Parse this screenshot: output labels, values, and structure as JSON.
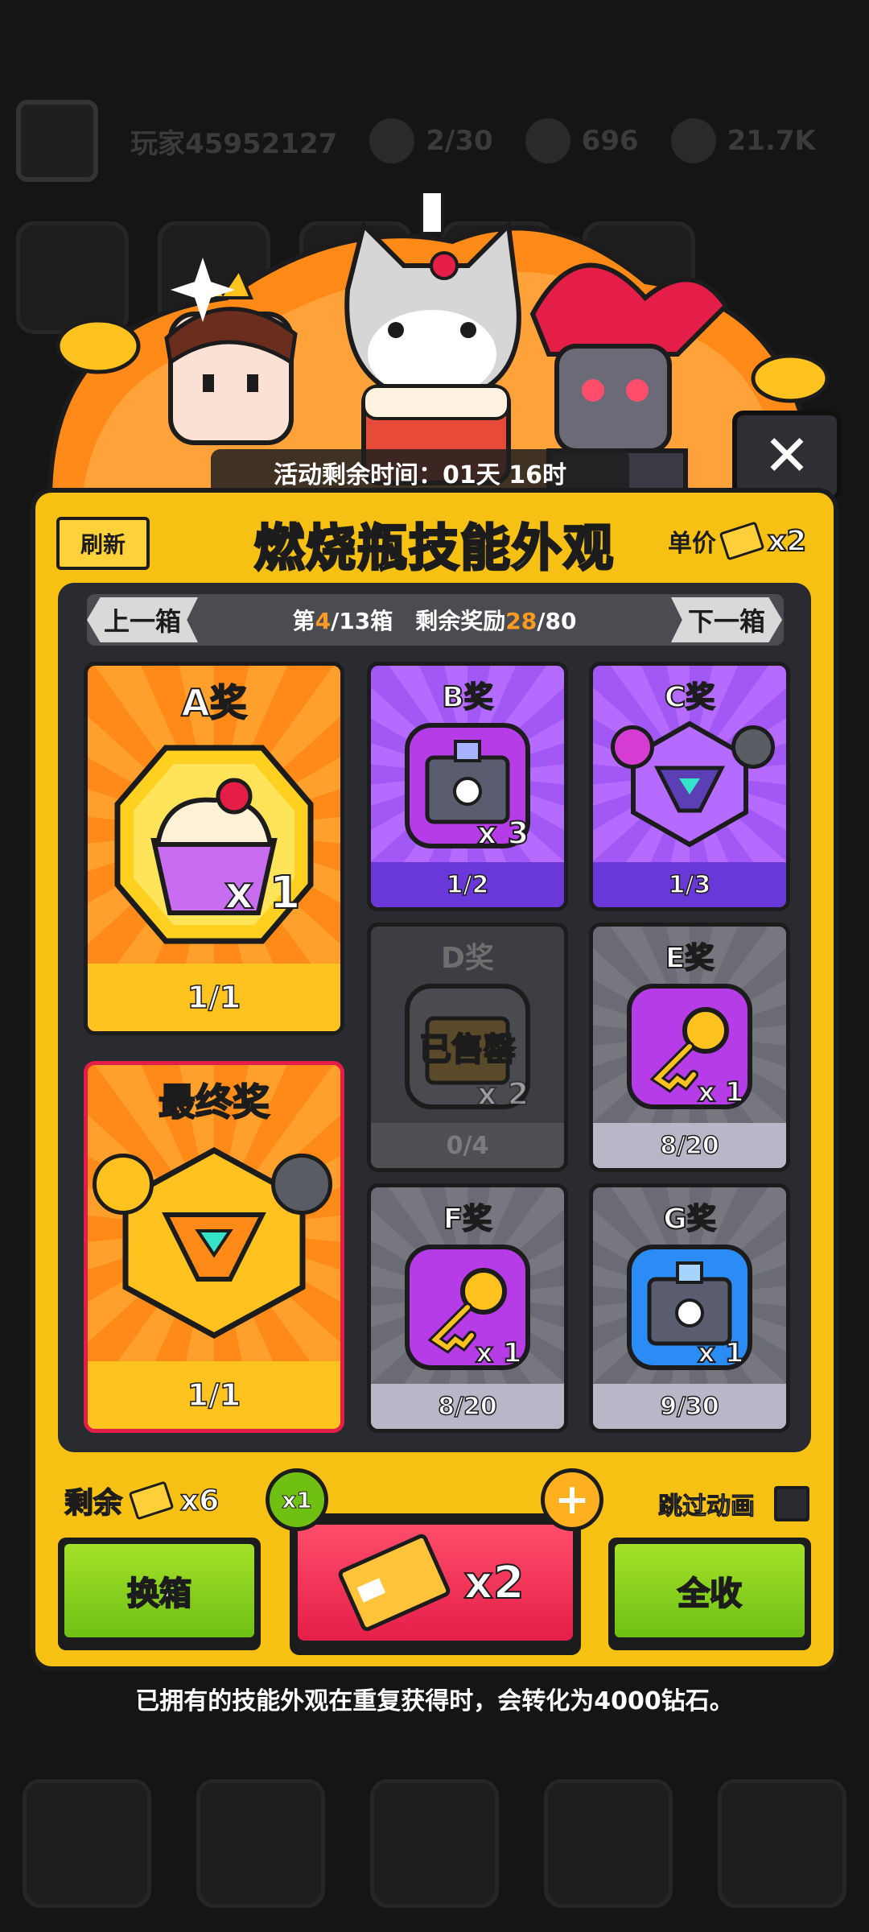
{
  "background": {
    "player_name": "玩家45952127",
    "stamina": "2/30",
    "gems": "696",
    "coins": "21.7K"
  },
  "event": {
    "timer_text": "活动剩余时间：01天 16时",
    "title": "燃烧瓶技能外观",
    "refresh_label": "刷新",
    "unit_price_label": "单价",
    "unit_price_qty": "x2"
  },
  "nav": {
    "prev_label": "上一箱",
    "next_label": "下一箱",
    "box_prefix": "第",
    "box_current": "4",
    "box_suffix": "/13箱",
    "reward_prefix": "剩余奖励",
    "reward_current": "28",
    "reward_suffix": "/80"
  },
  "prizes": [
    {
      "name": "A奖",
      "count": "1/1",
      "mult": "x 1",
      "icon": "cupcake-icon"
    },
    {
      "name": "B奖",
      "count": "1/2",
      "mult": "x 3",
      "icon": "chest-icon"
    },
    {
      "name": "C奖",
      "count": "1/3",
      "mult": "",
      "icon": "skill-emblem-icon"
    },
    {
      "name": "D奖",
      "count": "0/4",
      "mult": "x 2",
      "icon": "chest-icon",
      "sold_label": "已售罄"
    },
    {
      "name": "E奖",
      "count": "8/20",
      "mult": "x 1",
      "icon": "key-icon"
    },
    {
      "name": "最终奖",
      "count": "1/1",
      "mult": "",
      "icon": "skill-emblem-icon"
    },
    {
      "name": "F奖",
      "count": "8/20",
      "mult": "x 1",
      "icon": "key-icon"
    },
    {
      "name": "G奖",
      "count": "9/30",
      "mult": "x 1",
      "icon": "chest-icon"
    }
  ],
  "footer": {
    "remain_label": "剩余",
    "remain_qty": "x6",
    "skip_label": "跳过动画",
    "x1_badge": "x1",
    "plus_badge": "+",
    "swap_label": "换箱",
    "draw_qty": "x2",
    "collect_label": "全收",
    "notice": "已拥有的技能外观在重复获得时，会转化为4000钻石。"
  },
  "colors": {
    "panel": "#f7c114",
    "orange_card": "#ff8a17",
    "purple_card": "#a258f5",
    "grey_card": "#6a6b74",
    "draw_button": "#e51e48",
    "green_button": "#6fc013"
  }
}
